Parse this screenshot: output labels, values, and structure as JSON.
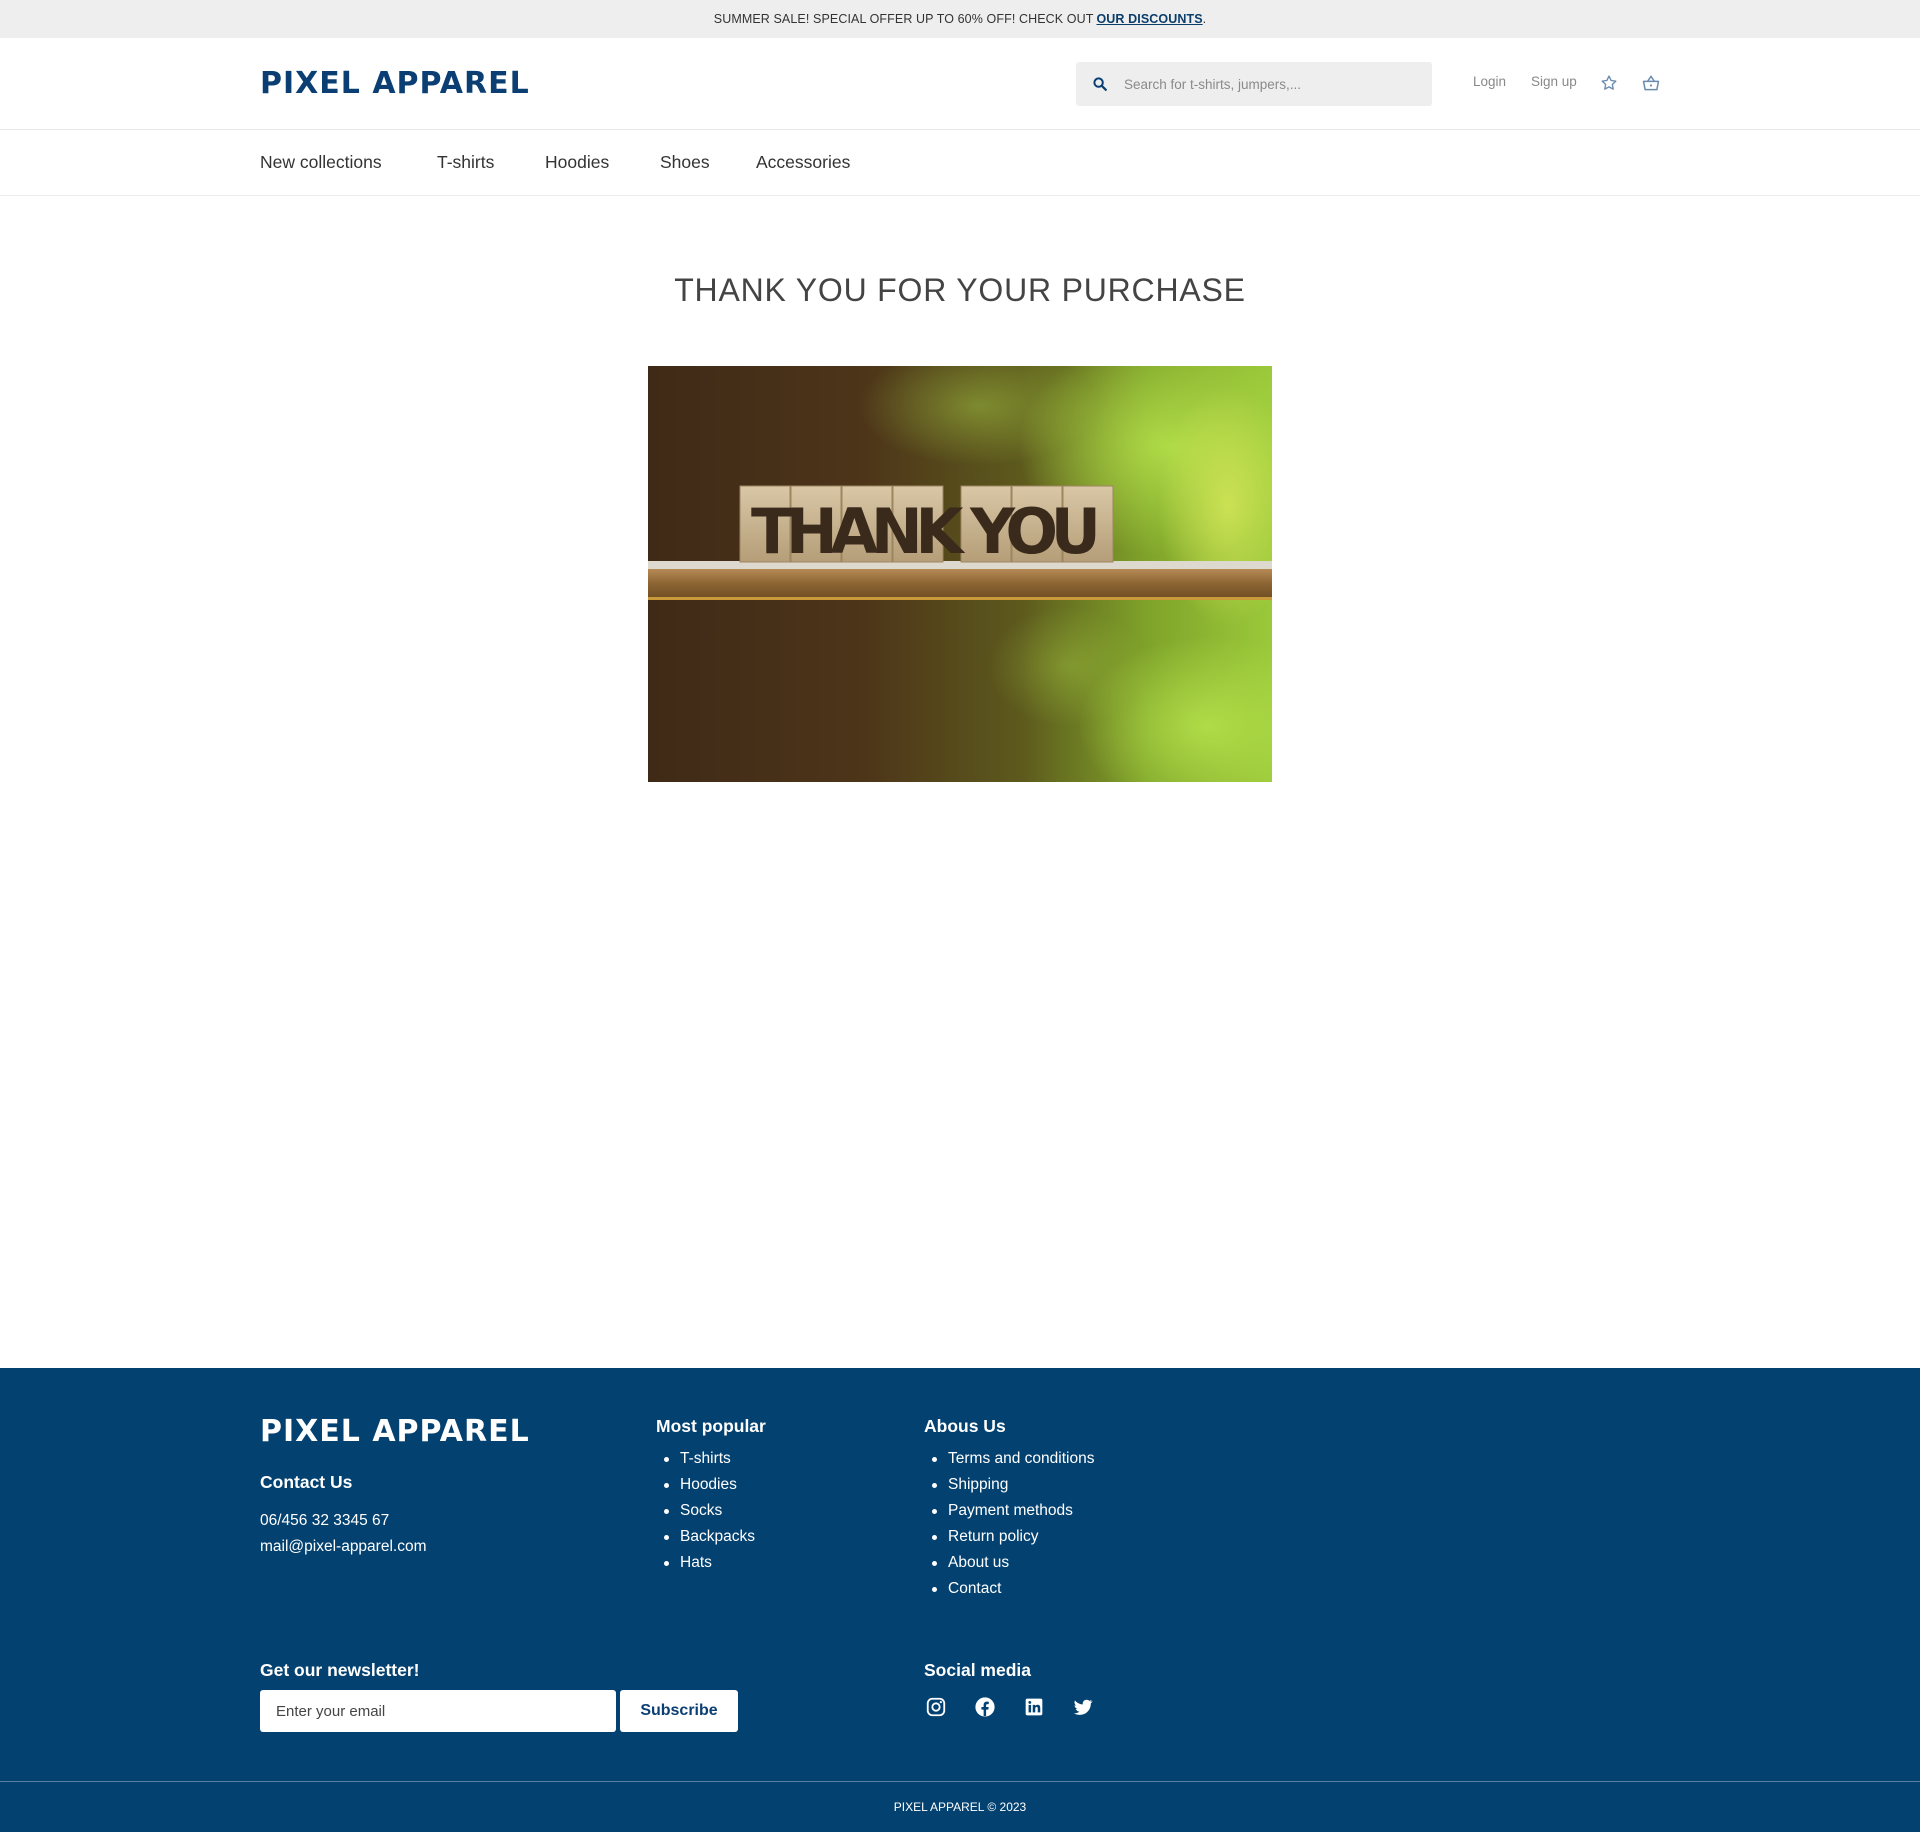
{
  "announcement": {
    "text": "SUMMER SALE! SPECIAL OFFER UP TO 60% OFF! CHECK OUT",
    "link": "OUR DISCOUNTS",
    "suffix": "."
  },
  "header": {
    "logo": "PIXEL APPAREL",
    "search_placeholder": "Search for t-shirts, jumpers,...",
    "login": "Login",
    "signup": "Sign up",
    "icons": [
      "search-icon",
      "star-icon",
      "basket-icon"
    ]
  },
  "nav": {
    "items": [
      "New collections",
      "T-shirts",
      "Hoodies",
      "Shoes",
      "Accessories"
    ]
  },
  "main": {
    "title": "THANK YOU FOR YOUR PURCHASE",
    "image_text": "THANK YOU"
  },
  "footer": {
    "logo": "PIXEL APPAREL",
    "contact": {
      "heading": "Contact Us",
      "phone": "06/456 32 3345 67",
      "email": "mail@pixel-apparel.com"
    },
    "popular": {
      "heading": "Most popular",
      "items": [
        "T-shirts",
        "Hoodies",
        "Socks",
        "Backpacks",
        "Hats"
      ]
    },
    "about": {
      "heading": "Abous Us",
      "items": [
        "Terms and conditions",
        "Shipping",
        "Payment methods",
        "Return policy",
        "About us",
        "Contact"
      ]
    },
    "newsletter": {
      "heading": "Get our newsletter!",
      "placeholder": "Enter your email",
      "button": "Subscribe"
    },
    "social": {
      "heading": "Social media",
      "icons": [
        "instagram-icon",
        "facebook-icon",
        "linkedin-icon",
        "twitter-icon"
      ]
    },
    "copyright": "PIXEL APPAREL © 2023"
  },
  "colors": {
    "brand": "#0b3f73",
    "footer_bg": "#034170",
    "announcement_bg": "#eeeeee"
  }
}
